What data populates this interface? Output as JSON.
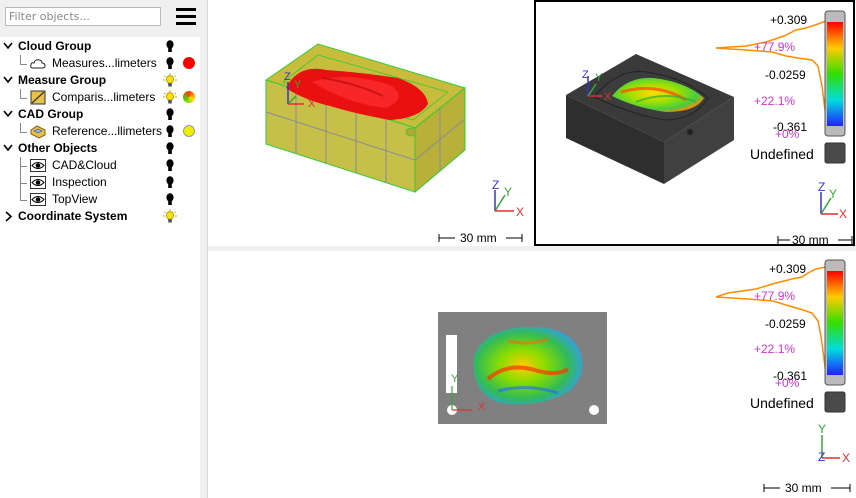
{
  "colors": {
    "accent_red": "#ff0000",
    "percent_magenta": "#cc33cc",
    "histogram_orange": "#ff8c00",
    "axis_x": "#e03030",
    "axis_y": "#33aa33",
    "axis_z": "#3333cc",
    "active_view_border": "#000000"
  },
  "sidebar": {
    "filter_placeholder": "Filter objects...",
    "menu_icon": "hamburger-menu-icon",
    "tree": [
      {
        "type": "group",
        "label": "Cloud Group",
        "visible_icon": "bulb-off-icon"
      },
      {
        "type": "child",
        "label": "Measures...limeters",
        "icon": "cloud-icon",
        "visible_icon": "bulb-off-icon",
        "color": "#ff0000"
      },
      {
        "type": "group",
        "label": "Measure Group",
        "visible_icon": "bulb-on-icon"
      },
      {
        "type": "child",
        "label": "Comparis...limeters",
        "icon": "comparison-icon",
        "visible_icon": "bulb-on-icon",
        "color": "gradient"
      },
      {
        "type": "group",
        "label": "CAD Group",
        "visible_icon": "bulb-off-icon"
      },
      {
        "type": "child",
        "label": "Reference...llimeters",
        "icon": "cad-part-icon",
        "visible_icon": "bulb-off-icon",
        "color": "#eeee00"
      },
      {
        "type": "group",
        "label": "Other Objects",
        "visible_icon": "bulb-off-icon"
      },
      {
        "type": "child",
        "label": "CAD&Cloud",
        "icon": "eye-icon",
        "visible_icon": "bulb-off-icon"
      },
      {
        "type": "child",
        "label": "Inspection",
        "icon": "eye-icon",
        "visible_icon": "bulb-off-icon"
      },
      {
        "type": "child",
        "label": "TopView",
        "icon": "eye-icon",
        "visible_icon": "bulb-off-icon"
      },
      {
        "type": "group",
        "label": "Coordinate System",
        "visible_icon": "bulb-on-icon"
      }
    ]
  },
  "views": {
    "top_left": {
      "scale_label": "30 mm",
      "axes": [
        "X",
        "Y",
        "Z"
      ]
    },
    "top_right": {
      "scale_label": "30 mm",
      "axes": [
        "X",
        "Y",
        "Z"
      ],
      "scale_max": "+0.309",
      "scale_mid": "-0.0259",
      "scale_min": "-0.361",
      "pct_1": "+77.9%",
      "pct_2": "+22.1%",
      "pct_3": "+0%",
      "undefined_label": "Undefined"
    },
    "bottom": {
      "scale_label": "30 mm",
      "axes": [
        "X",
        "Y",
        "Z"
      ],
      "scale_max": "+0.309",
      "scale_mid": "-0.0259",
      "scale_min": "-0.361",
      "pct_1": "+77.9%",
      "pct_2": "+22.1%",
      "pct_3": "+0%",
      "undefined_label": "Undefined"
    }
  }
}
